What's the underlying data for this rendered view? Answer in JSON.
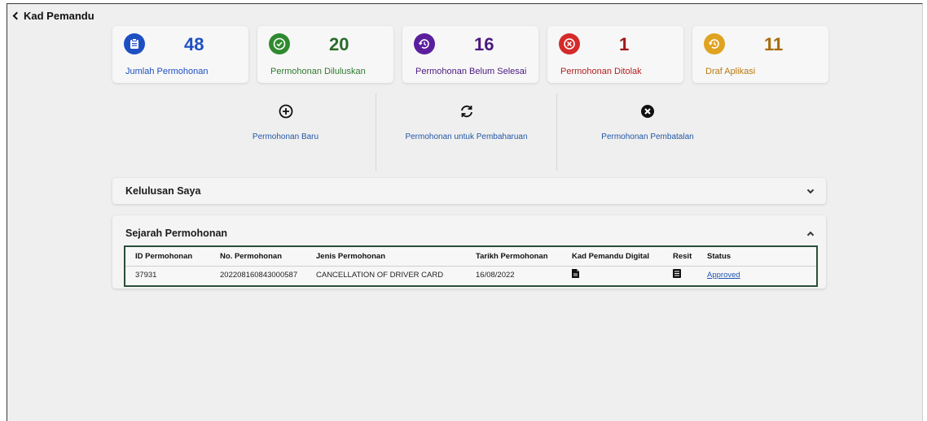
{
  "header": {
    "back_label": "Kad Pemandu"
  },
  "stats": [
    {
      "number": "48",
      "label": "Jumlah Permohonan",
      "color": "#1e4fc2",
      "icon": "clipboard-icon"
    },
    {
      "number": "20",
      "label": "Permohonan Diluluskan",
      "color": "#2f8a2f",
      "icon": "check-circle-icon"
    },
    {
      "number": "16",
      "label": "Permohonan Belum Selesai",
      "color": "#5b1f9e",
      "icon": "history-icon"
    },
    {
      "number": "1",
      "label": "Permohonan Ditolak",
      "color": "#d42a2a",
      "icon": "cancel-circle-icon"
    },
    {
      "number": "11",
      "label": "Draf Aplikasi",
      "color": "#c88a12",
      "icon": "history-icon"
    }
  ],
  "actions": [
    {
      "label": "Permohonan Baru",
      "icon": "plus-circle-icon"
    },
    {
      "label": "Permohonan untuk Pembaharuan",
      "icon": "refresh-icon"
    },
    {
      "label": "Permohonan Pembatalan",
      "icon": "close-circle-icon"
    }
  ],
  "panels": {
    "approvals_title": "Kelulusan Saya",
    "history_title": "Sejarah Permohonan"
  },
  "table": {
    "headers": [
      "ID Permohonan",
      "No. Permohonan",
      "Jenis Permohonan",
      "Tarikh Permohonan",
      "Kad Pemandu Digital",
      "Resit",
      "Status"
    ],
    "rows": [
      {
        "id": "37931",
        "no": "202208160843000587",
        "jenis": "CANCELLATION OF DRIVER CARD",
        "tarikh": "16/08/2022",
        "kad_icon": "document-icon",
        "resit_icon": "receipt-icon",
        "status": "Approved"
      }
    ]
  }
}
